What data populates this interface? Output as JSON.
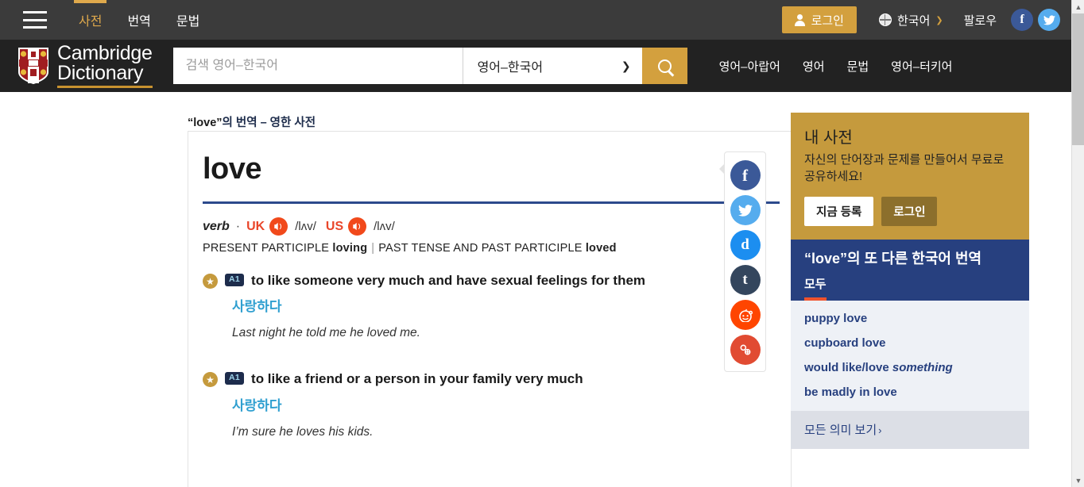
{
  "topbar": {
    "menu_icon": "hamburger-icon",
    "nav": [
      {
        "label": "사전",
        "active": true
      },
      {
        "label": "번역",
        "active": false
      },
      {
        "label": "문법",
        "active": false
      }
    ],
    "login_label": "로그인",
    "language_label": "한국어",
    "follow_label": "팔로우",
    "social": [
      {
        "name": "facebook-icon",
        "glyph": "f"
      },
      {
        "name": "twitter-icon",
        "glyph": "🐦"
      }
    ]
  },
  "header": {
    "logo_line1": "Cambridge",
    "logo_line2": "Dictionary",
    "search_placeholder": "검색 영어–한국어",
    "search_value": "",
    "dictionary_selected": "영어–한국어",
    "search_button": "search-icon",
    "links": [
      "영어–아랍어",
      "영어",
      "문법",
      "영어–터키어"
    ]
  },
  "breadcrumb": {
    "quoted": "“love”",
    "rest": "의 번역 – 영한 사전"
  },
  "entry": {
    "headword": "love",
    "pos": "verb",
    "separator": "·",
    "uk_label": "UK",
    "uk_ipa": "/lʌv/",
    "us_label": "US",
    "us_ipa": "/lʌv/",
    "inflection_present_label": "PRESENT PARTICIPLE",
    "inflection_present_value": "loving",
    "inflection_sep": "|",
    "inflection_past_label": "PAST TENSE AND PAST PARTICIPLE",
    "inflection_past_value": "loved",
    "senses": [
      {
        "level": "A1",
        "definition": "to like someone very much and have sexual feelings for them",
        "translation": "사랑하다",
        "example": "Last night he told me he loved me."
      },
      {
        "level": "A1",
        "definition": "to like a friend or a person in your family very much",
        "translation": "사랑하다",
        "example": "I’m sure he loves his kids."
      }
    ]
  },
  "share_rail": [
    {
      "name": "facebook-share-icon",
      "glyph": "f"
    },
    {
      "name": "twitter-share-icon",
      "glyph": "🐦"
    },
    {
      "name": "diigo-share-icon",
      "glyph": "d"
    },
    {
      "name": "tumblr-share-icon",
      "glyph": "t"
    },
    {
      "name": "reddit-share-icon",
      "glyph": "👽"
    },
    {
      "name": "copy-link-icon",
      "glyph": "🔗"
    }
  ],
  "sidebar": {
    "my_dictionary": {
      "title": "내 사전",
      "description": "자신의 단어장과 문제를 만들어서 무료로 공유하세요!",
      "register_label": "지금 등록",
      "login_label": "로그인"
    },
    "other_translations": {
      "title": "“love”의 또 다른 한국어 번역",
      "tab_label": "모두",
      "items": [
        {
          "text": "puppy love",
          "italic": ""
        },
        {
          "text": "cupboard love",
          "italic": ""
        },
        {
          "text": "would like/love ",
          "italic": "something"
        },
        {
          "text": "be madly in love",
          "italic": ""
        }
      ],
      "footer_label": "모든 의미 보기",
      "footer_chevron": "›"
    }
  },
  "colors": {
    "gold": "#d3a03e",
    "dark_bar": "#3b3b3b",
    "header_bg": "#222222",
    "navy": "#27407f",
    "accent_blue": "#2c4a8c",
    "translation_blue": "#2f9fd0",
    "speaker_red": "#f1491b",
    "tab_underline": "#f0532d"
  }
}
